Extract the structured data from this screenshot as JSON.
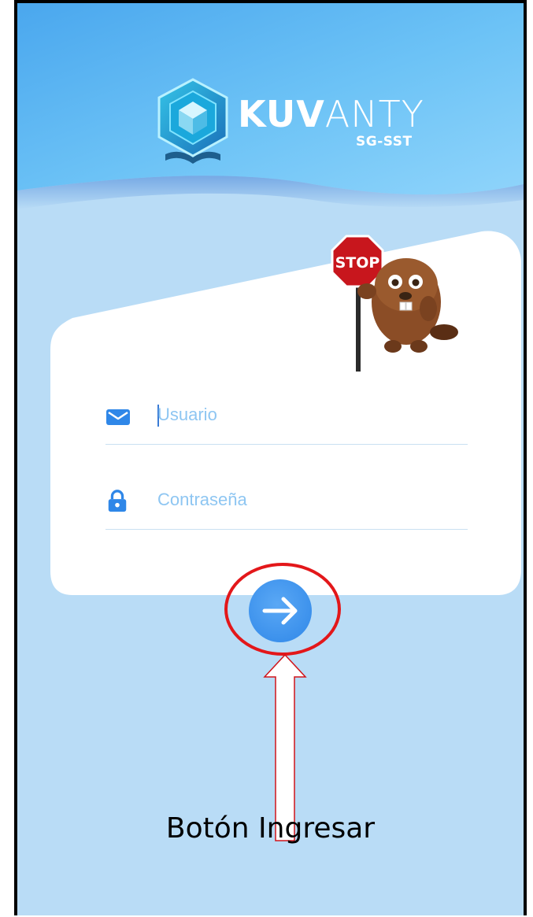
{
  "app": {
    "brand_bold": "KUV",
    "brand_light": "ANTY",
    "brand_subtitle": "SG-SST"
  },
  "mascot": {
    "sign_text": "STOP"
  },
  "login": {
    "username_placeholder": "Usuario",
    "password_placeholder": "Contraseña",
    "submit_icon": "arrow-right-icon"
  },
  "annotation": {
    "caption": "Botón Ingresar",
    "color": "#e3171a"
  },
  "colors": {
    "primary": "#2f87e8",
    "background": "#b9dcf6",
    "header_top": "#5fb4f5"
  }
}
